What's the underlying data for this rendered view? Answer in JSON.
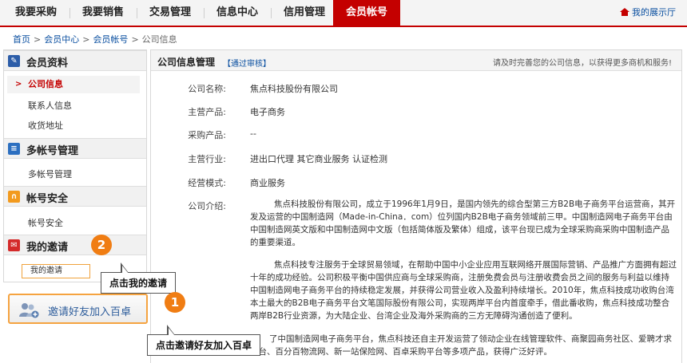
{
  "nav": {
    "tabs": [
      "我要采购",
      "我要销售",
      "交易管理",
      "信息中心",
      "信用管理",
      "会员帐号"
    ],
    "active_tab": "会员帐号",
    "showroom": "我的展示厅"
  },
  "breadcrumb": [
    "首页",
    "会员中心",
    "会员帐号",
    "公司信息"
  ],
  "sidebar": {
    "sections": [
      {
        "title": "会员资料",
        "icon": "member-info-icon",
        "items": [
          "公司信息",
          "联系人信息",
          "收货地址"
        ]
      },
      {
        "title": "多帐号管理",
        "icon": "multi-account-icon",
        "items": [
          "多帐号管理"
        ]
      },
      {
        "title": "帐号安全",
        "icon": "lock-icon",
        "items": [
          "帐号安全"
        ]
      },
      {
        "title": "我的邀请",
        "icon": "invite-icon",
        "items": [
          "我的邀请"
        ]
      }
    ],
    "active_item": "公司信息",
    "invite_button": "邀请好友加入百卓"
  },
  "main": {
    "title": "公司信息管理",
    "audit_status": "【通过审核】",
    "tip": "请及时完善您的公司信息，以获得更多商机和服务!",
    "fields": [
      {
        "label": "公司名称:",
        "value": "焦点科技股份有限公司"
      },
      {
        "label": "主营产品:",
        "value": "电子商务"
      },
      {
        "label": "采购产品:",
        "value": "--"
      },
      {
        "label": "主营行业:",
        "value": "进出口代理  其它商业服务  认证检测"
      },
      {
        "label": "经营模式:",
        "value": "商业服务"
      }
    ],
    "intro_label": "公司介绍:",
    "intro_paragraphs": [
      "焦点科技股份有限公司，成立于1996年1月9日，是国内领先的综合型第三方B2B电子商务平台运营商，其开发及运营的中国制造网（Made-in-China．com）位列国内B2B电子商务领域前三甲。中国制造网电子商务平台由中国制造网英文版和中国制造网中文版（包括简体版及繁体）组成，该平台现已成为全球采购商采购中国制造产品的重要渠道。",
      "焦点科技专注服务于全球贸易领域，在帮助中国中小企业应用互联网络开展国际营销、产品推广方面拥有超过十年的成功经验。公司积极平衡中国供应商与全球采购商，注册免费会员与注册收费会员之间的服务与利益以维持中国制造网电子商务平台的持续稳定发展，并获得公司营业收入及盈利持续增长。2010年，焦点科技成功收购台湾本土最大的B2B电子商务平台文笔国际股份有限公司，实现两岸平台内首度牵手，借此番收购，焦点科技成功整合两岸B2B行业资源，为大陆企业、台湾企业及海外采购商的三方无障碍沟通创造了便利。",
      "了中国制造网电子商务平台，焦点科技还自主开发运营了领动企业在线管理软件、商聚园商务社区、爱聘才求平台、百分百物流网、新一站保险网、百卓采购平台等多项产品，获得广泛好评。"
    ]
  },
  "callouts": {
    "step1_number": "1",
    "step1_text": "点击邀请好友加入百卓",
    "step2_number": "2",
    "step2_text": "点击我的邀请"
  },
  "colors": {
    "accent_red": "#c40000",
    "link_blue": "#0a4fa0",
    "callout_orange": "#f07d13"
  }
}
